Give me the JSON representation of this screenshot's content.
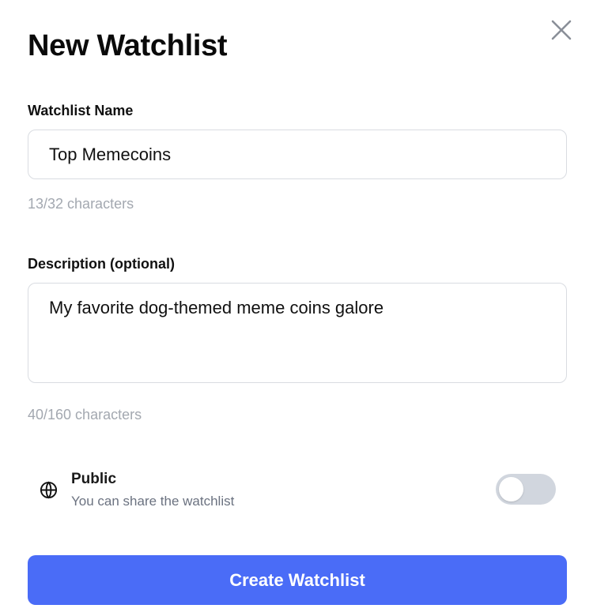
{
  "modal": {
    "title": "New Watchlist"
  },
  "name_field": {
    "label": "Watchlist Name",
    "value": "Top Memecoins",
    "counter": "13/32 characters"
  },
  "description_field": {
    "label": "Description (optional)",
    "value": "My favorite dog-themed meme coins galore",
    "counter": "40/160 characters"
  },
  "visibility": {
    "title": "Public",
    "subtitle": "You can share the watchlist",
    "enabled": false,
    "icon": "globe-icon"
  },
  "actions": {
    "create_label": "Create Watchlist",
    "close_icon": "close-icon"
  },
  "colors": {
    "primary": "#4a6cf7",
    "toggle_off": "#d1d6de",
    "muted_text": "#a3a8b0",
    "border": "#d9dce1"
  }
}
